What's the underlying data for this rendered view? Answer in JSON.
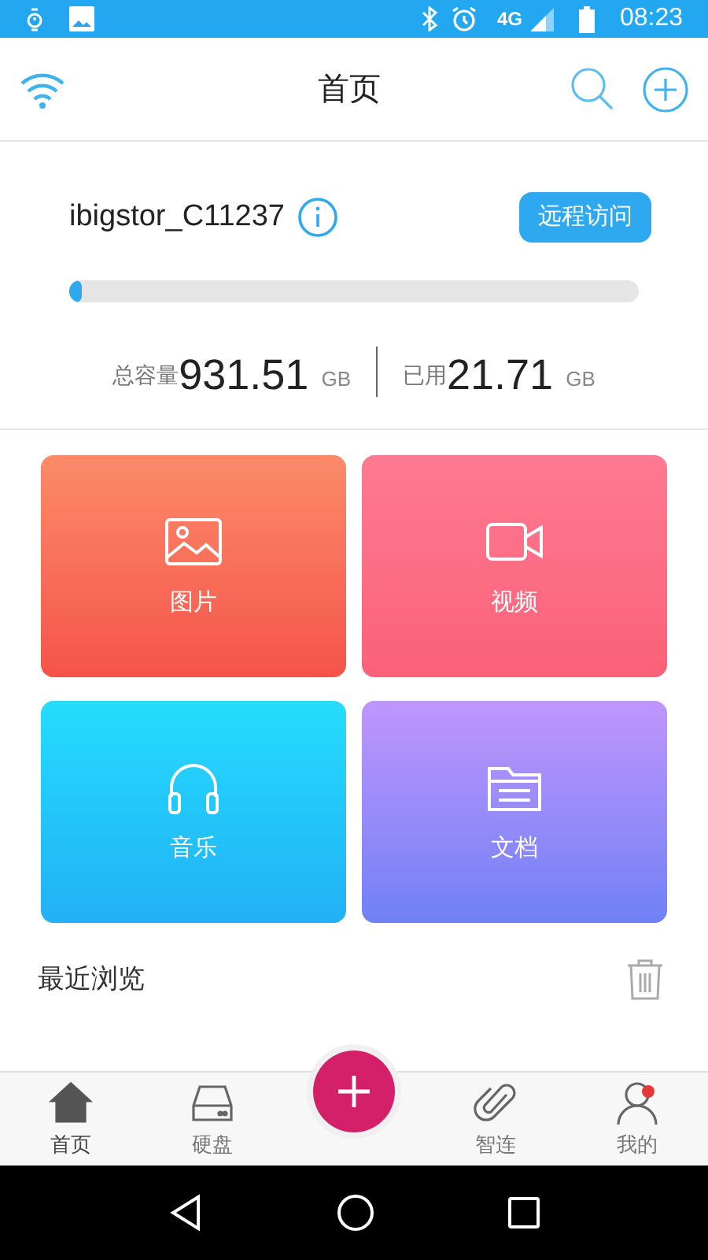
{
  "status_bar": {
    "time": "08:23",
    "network": "4G"
  },
  "header": {
    "title": "首页"
  },
  "device": {
    "name": "ibigstor_C11237",
    "remote_button": "远程访问",
    "storage": {
      "level": 0.015
    },
    "total_label": "总容量",
    "total_value": "931.51",
    "total_unit": "GB",
    "used_label": "已用",
    "used_value": "21.71",
    "used_unit": "GB"
  },
  "categories": [
    {
      "kind": "image",
      "label": "图片"
    },
    {
      "kind": "video",
      "label": "视频"
    },
    {
      "kind": "music",
      "label": "音乐"
    },
    {
      "kind": "document",
      "label": "文档"
    }
  ],
  "recent": {
    "title": "最近浏览"
  },
  "tabs": [
    {
      "kind": "home",
      "label": "首页",
      "selected": true,
      "badge": false
    },
    {
      "kind": "disk",
      "label": "硬盘",
      "selected": false,
      "badge": false
    },
    {
      "kind": "link",
      "label": "智连",
      "selected": false,
      "badge": false
    },
    {
      "kind": "me",
      "label": "我的",
      "selected": false,
      "badge": true
    }
  ]
}
